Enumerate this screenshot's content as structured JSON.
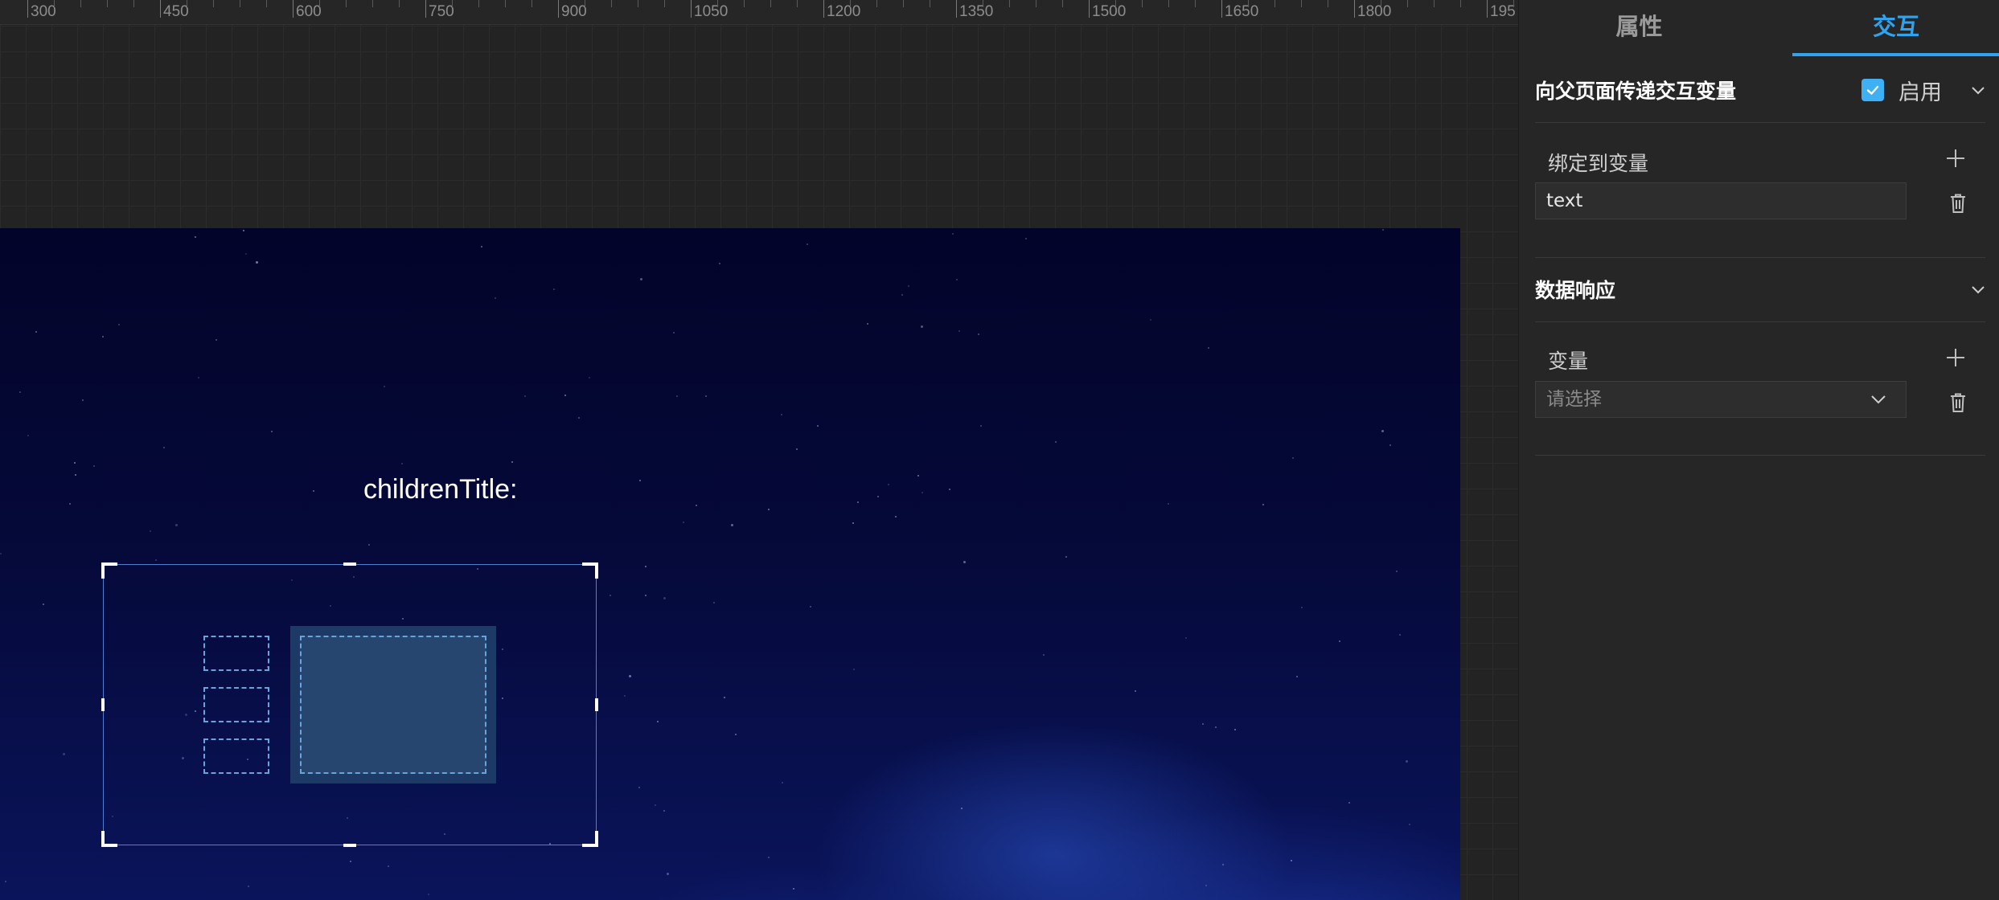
{
  "ruler": {
    "labels": [
      "300",
      "450",
      "600",
      "750",
      "900",
      "1050",
      "1200",
      "1350",
      "1500",
      "1650",
      "1800",
      "195"
    ]
  },
  "canvas": {
    "children_title": "childrenTitle:"
  },
  "panel": {
    "tabs": [
      {
        "label": "属性",
        "active": false
      },
      {
        "label": "交互",
        "active": true
      }
    ],
    "section_parent": {
      "title": "向父页面传递交互变量",
      "enabled": true,
      "enable_label": "启用",
      "bind_label": "绑定到变量",
      "bind_value": "text"
    },
    "section_response": {
      "title": "数据响应",
      "var_label": "变量",
      "select_placeholder": "请选择"
    }
  },
  "colors": {
    "accent": "#2fa3f0",
    "checkbox": "#3fb0f3",
    "selection": "#4d7dd6"
  }
}
